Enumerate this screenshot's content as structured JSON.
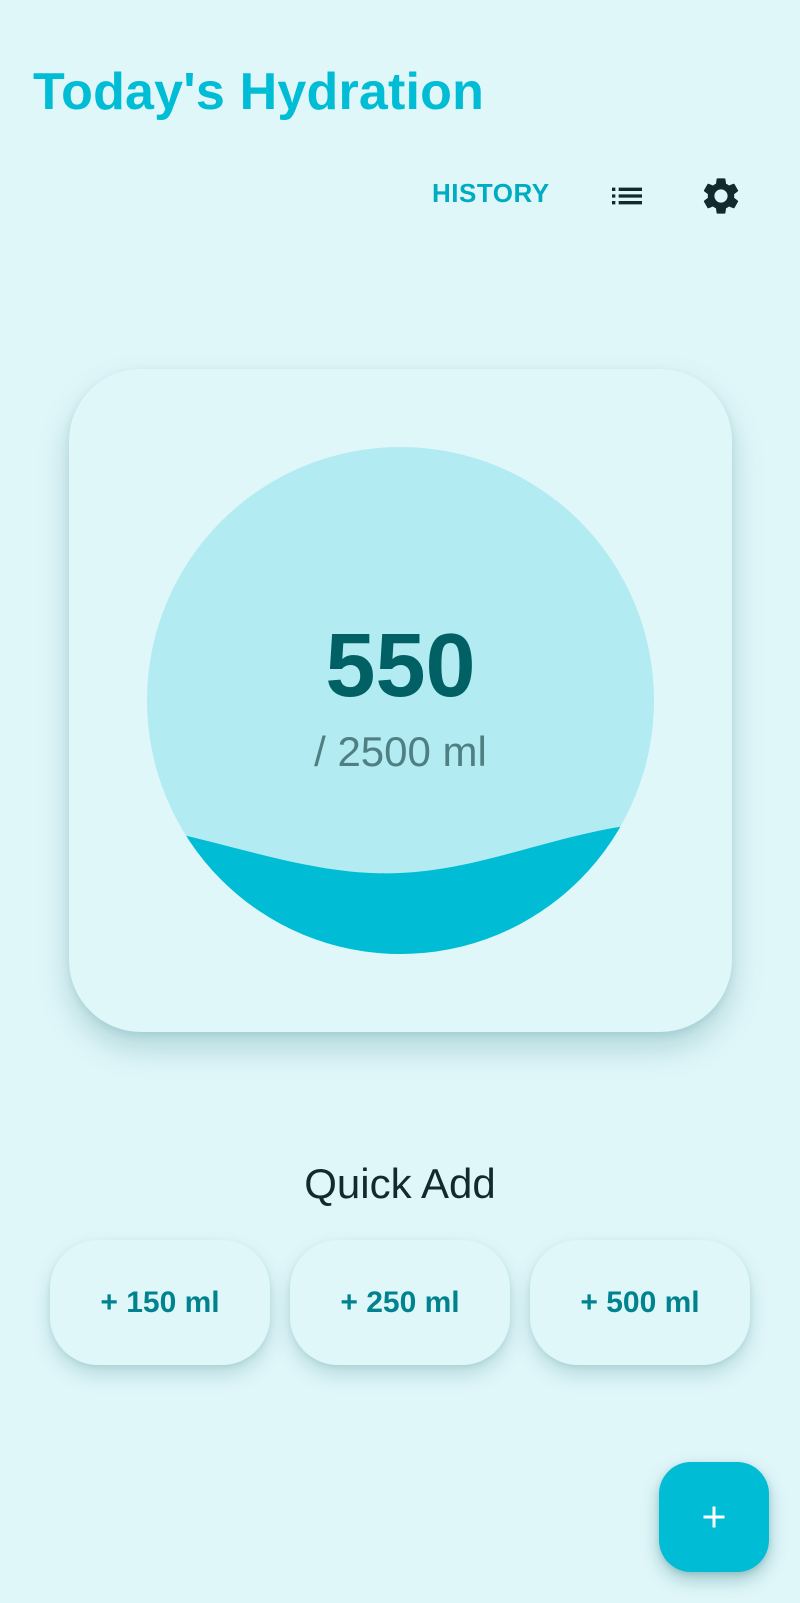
{
  "header": {
    "title": "Today's Hydration"
  },
  "toolbar": {
    "history_label": "HISTORY",
    "list_icon": "list-icon",
    "settings_icon": "gear-icon"
  },
  "progress": {
    "current": "550",
    "goal_text": "/ 2500 ml",
    "current_ml": 550,
    "goal_ml": 2500,
    "fill_color": "#00bcd4",
    "empty_color": "#b2ebf2"
  },
  "quick_add": {
    "title": "Quick Add",
    "buttons": [
      "+ 150 ml",
      "+ 250 ml",
      "+ 500 ml"
    ]
  },
  "fab": {
    "icon": "plus-icon"
  },
  "colors": {
    "background": "#e0f7fa",
    "accent": "#00bcd4",
    "text_dark": "#006064"
  }
}
